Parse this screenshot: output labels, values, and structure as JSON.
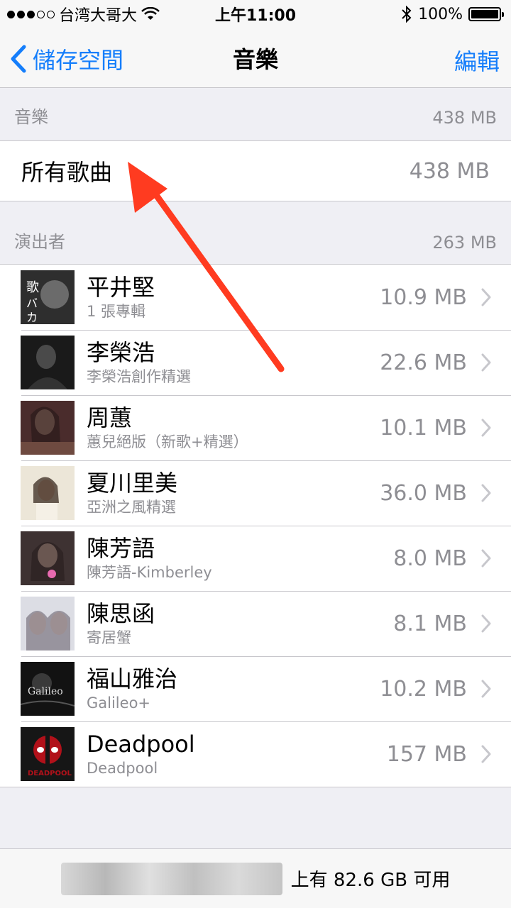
{
  "status_bar": {
    "carrier": "台湾大哥大",
    "time": "上午11:00",
    "battery": "100%",
    "battery_level": 1.0
  },
  "nav": {
    "back_label": "儲存空間",
    "title": "音樂",
    "edit_label": "編輯"
  },
  "music_section": {
    "header": "音樂",
    "header_size": "438 MB",
    "all_songs_label": "所有歌曲",
    "all_songs_size": "438 MB"
  },
  "artists_section": {
    "header": "演出者",
    "header_size": "263 MB",
    "items": [
      {
        "name": "平井堅",
        "subtitle": "1 張專輯",
        "size": "10.9 MB",
        "thumb_color": "#3a3a3a"
      },
      {
        "name": "李榮浩",
        "subtitle": "李榮浩創作精選",
        "size": "22.6 MB",
        "thumb_color": "#1c1c1c"
      },
      {
        "name": "周蕙",
        "subtitle": "蕙兒絕版（新歌+精選）",
        "size": "10.1 MB",
        "thumb_color": "#5a3030"
      },
      {
        "name": "夏川里美",
        "subtitle": "亞洲之風精選",
        "size": "36.0 MB",
        "thumb_color": "#e8e2d6"
      },
      {
        "name": "陳芳語",
        "subtitle": "陳芳語-Kimberley",
        "size": "8.0 MB",
        "thumb_color": "#4a3a3a"
      },
      {
        "name": "陳思函",
        "subtitle": "寄居蟹",
        "size": "8.1 MB",
        "thumb_color": "#d6d8e0"
      },
      {
        "name": "福山雅治",
        "subtitle": "Galileo+",
        "size": "10.2 MB",
        "thumb_color": "#141414"
      },
      {
        "name": "Deadpool",
        "subtitle": "Deadpool",
        "size": "157 MB",
        "thumb_color": "#1a1a1a"
      }
    ]
  },
  "footer": {
    "available_text": "上有 82.6 GB 可用"
  },
  "colors": {
    "accent": "#157efb",
    "annotation_arrow": "#ff3b20"
  }
}
